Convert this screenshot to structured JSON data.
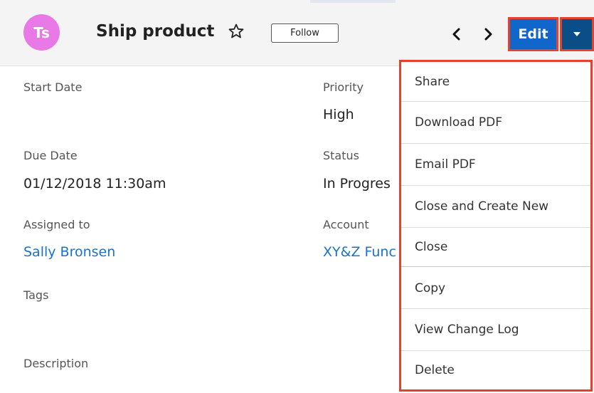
{
  "header": {
    "avatar_initials": "Ts",
    "avatar_color": "#e879e6",
    "title": "Ship product",
    "follow_label": "Follow",
    "edit_label": "Edit"
  },
  "fields": {
    "start_date": {
      "label": "Start Date",
      "value": ""
    },
    "priority": {
      "label": "Priority",
      "value": "High"
    },
    "due_date": {
      "label": "Due Date",
      "value": "01/12/2018 11:30am"
    },
    "status": {
      "label": "Status",
      "value": "In Progres"
    },
    "assigned_to": {
      "label": "Assigned to",
      "value": "Sally Bronsen"
    },
    "account": {
      "label": "Account",
      "value": "XY&Z Func"
    },
    "tags": {
      "label": "Tags"
    },
    "description": {
      "label": "Description"
    }
  },
  "menu": {
    "items": [
      {
        "label": "Share"
      },
      {
        "label": "Download PDF"
      },
      {
        "label": "Email PDF"
      },
      {
        "label": "Close and Create New"
      },
      {
        "label": "Close"
      },
      {
        "label": "Copy"
      },
      {
        "label": "View Change Log"
      },
      {
        "label": "Delete"
      }
    ]
  },
  "colors": {
    "primary_button": "#1166cc",
    "highlight_border": "#e5412d",
    "link": "#1a73c8"
  }
}
